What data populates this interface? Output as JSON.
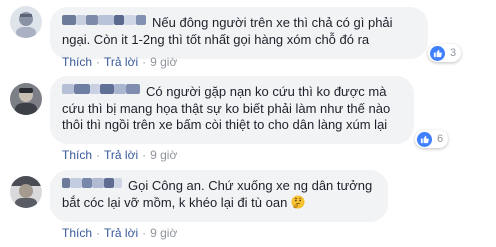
{
  "comments": [
    {
      "text": "Nếu đông người trên xe thì chả có gì phải ngại. Còn it 1-2ng thì tốt nhất gọi hàng xóm chỗ đó ra",
      "like_count": "3",
      "actions": {
        "like": "Thích",
        "reply": "Trả lời",
        "time": "9 giờ"
      }
    },
    {
      "text": "Có người gặp nạn ko cứu thì ko được mà cứu thì bị mang họa thật sự ko biết phải làm như thế nào thôi thì ngồi trên xe bấm còi thiệt to cho dân làng xúm lại",
      "like_count": "6",
      "actions": {
        "like": "Thích",
        "reply": "Trả lời",
        "time": "9 giờ"
      }
    },
    {
      "text": "Gọi Công an. Chứ xuống xe ng dân tưởng bắt cóc lại vỡ mồm, k khéo lại đi tù oan",
      "emoji": "thinking-face",
      "like_count": "",
      "actions": {
        "like": "Thích",
        "reply": "Trả lời",
        "time": "9 giờ"
      }
    }
  ],
  "colors": {
    "bubble": "#f2f3f5",
    "link": "#385898",
    "like_blue": "#4080ff",
    "text": "#1d2129",
    "muted": "#90949c"
  }
}
